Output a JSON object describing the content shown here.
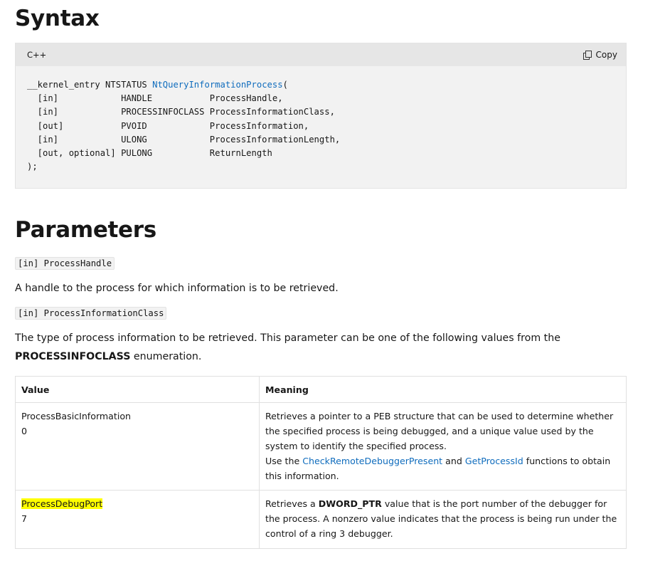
{
  "syntax": {
    "heading": "Syntax",
    "code_lang": "C++",
    "copy_label": "Copy",
    "code": {
      "prefix": "__kernel_entry NTSTATUS ",
      "function_name": "NtQueryInformationProcess",
      "open_paren": "(",
      "lines": [
        "  [in]            HANDLE           ProcessHandle,",
        "  [in]            PROCESSINFOCLASS ProcessInformationClass,",
        "  [out]           PVOID            ProcessInformation,",
        "  [in]            ULONG            ProcessInformationLength,",
        "  [out, optional] PULONG           ReturnLength"
      ],
      "close": ");"
    }
  },
  "parameters": {
    "heading": "Parameters",
    "param1": {
      "code": "[in] ProcessHandle",
      "description": "A handle to the process for which information is to be retrieved."
    },
    "param2": {
      "code": "[in] ProcessInformationClass",
      "description_start": "The type of process information to be retrieved. This parameter can be one of the following values from the ",
      "description_bold": "PROCESSINFOCLASS",
      "description_end": " enumeration."
    }
  },
  "table": {
    "headers": [
      "Value",
      "Meaning"
    ],
    "rows": [
      {
        "name": "ProcessBasicInformation",
        "value": "0",
        "meaning_text": "Retrieves a pointer to a PEB structure that can be used to determine whether the specified process is being debugged, and a unique value used by the system to identify the specified process.",
        "meaning_use_prefix": "Use the ",
        "link1": "CheckRemoteDebuggerPresent",
        "meaning_and": " and ",
        "link2": "GetProcessId",
        "meaning_suffix": " functions to obtain this information."
      },
      {
        "name": "ProcessDebugPort",
        "value": "7",
        "meaning_prefix": "Retrieves a ",
        "meaning_bold": "DWORD_PTR",
        "meaning_rest": " value that is the port number of the debugger for the process. A nonzero value indicates that the process is being run under the control of a ring 3 debugger."
      }
    ]
  },
  "colors": {
    "link": "#0f6cbd",
    "highlight": "#ffff00",
    "code_bg": "#f2f2f2",
    "code_header_bg": "#e6e6e6"
  }
}
